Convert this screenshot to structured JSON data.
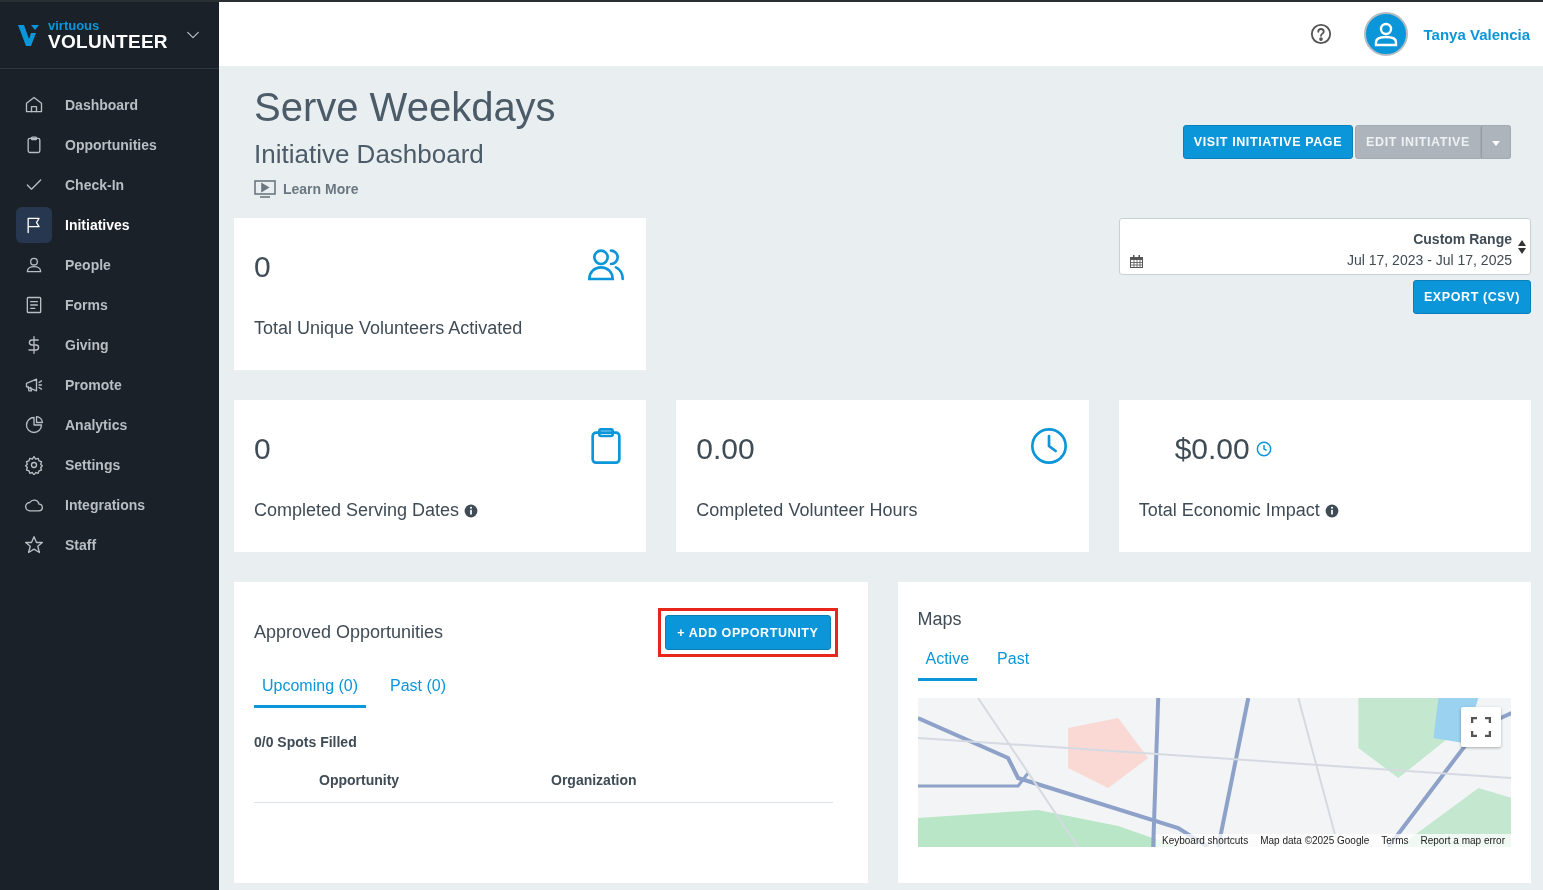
{
  "brand": {
    "small": "virtuous",
    "big": "VOLUNTEER"
  },
  "sidebar": {
    "items": [
      {
        "label": "Dashboard",
        "selected": false
      },
      {
        "label": "Opportunities",
        "selected": false
      },
      {
        "label": "Check-In",
        "selected": false
      },
      {
        "label": "Initiatives",
        "selected": true
      },
      {
        "label": "People",
        "selected": false
      },
      {
        "label": "Forms",
        "selected": false
      },
      {
        "label": "Giving",
        "selected": false
      },
      {
        "label": "Promote",
        "selected": false
      },
      {
        "label": "Analytics",
        "selected": false
      },
      {
        "label": "Settings",
        "selected": false
      },
      {
        "label": "Integrations",
        "selected": false
      },
      {
        "label": "Staff",
        "selected": false
      }
    ]
  },
  "header": {
    "user_name": "Tanya Valencia"
  },
  "page": {
    "title": "Serve Weekdays",
    "subtitle": "Initiative Dashboard",
    "learn_more": "Learn More"
  },
  "actions": [
    {
      "label": "VISIT INITIATIVE PAGE",
      "kind": "primary"
    },
    {
      "label": "EDIT INITIATIVE",
      "kind": "split"
    }
  ],
  "date_range": {
    "label": "Custom Range",
    "value": "Jul 17, 2023 - Jul 17, 2025"
  },
  "export_button": "EXPORT (CSV)",
  "stats": [
    {
      "value": "0",
      "label": "Total Unique Volunteers Activated",
      "info": false
    },
    {
      "value": "0",
      "label": "Completed Serving Dates",
      "info": true
    },
    {
      "value": "0.00",
      "label": "Completed Volunteer Hours",
      "info": false
    },
    {
      "value": "$0.00",
      "label": "Total Economic Impact",
      "info": true
    }
  ],
  "opportunities": {
    "title": "Approved Opportunities",
    "add_button": {
      "label": "+ ADD OPPORTUNITY",
      "highlighted": true
    },
    "tabs": [
      {
        "label": "Upcoming (0)",
        "selected": true
      },
      {
        "label": "Past (0)",
        "selected": false
      }
    ],
    "spots": "0/0 Spots Filled",
    "columns": [
      "Opportunity",
      "Organization"
    ]
  },
  "maps": {
    "title": "Maps",
    "tabs": [
      {
        "label": "Active",
        "selected": true
      },
      {
        "label": "Past",
        "selected": false
      }
    ],
    "attribution": [
      "Keyboard shortcuts",
      "Map data ©2025 Google",
      "Terms",
      "Report a map error"
    ]
  }
}
